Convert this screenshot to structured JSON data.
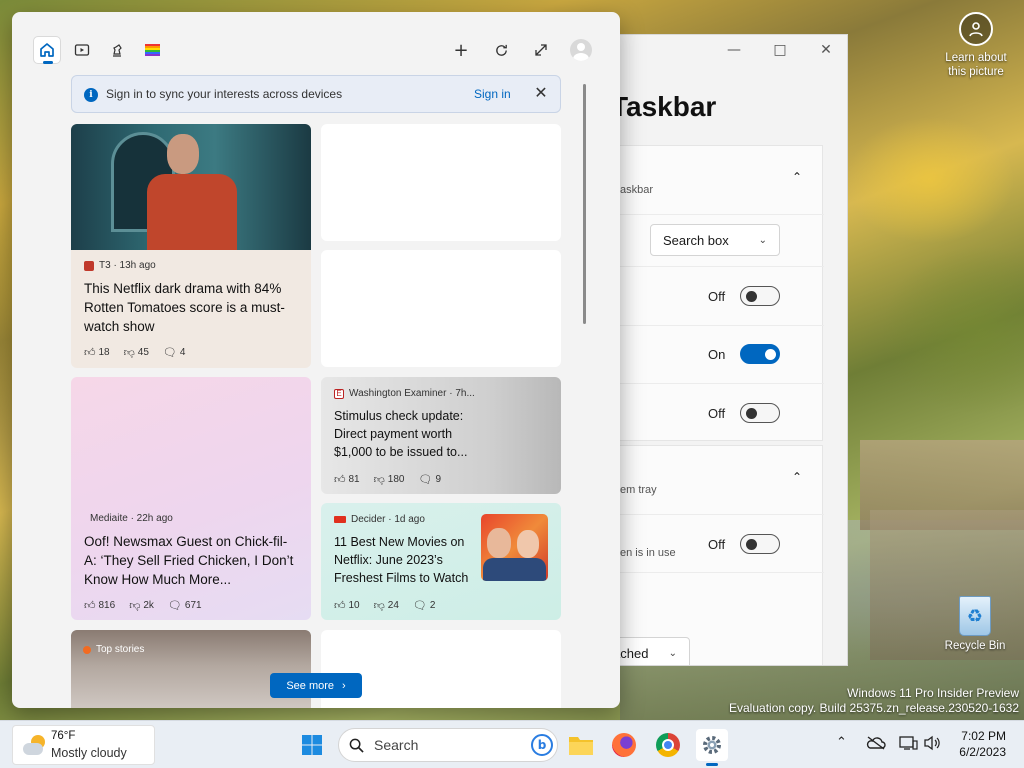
{
  "desktop": {
    "learn_about_line1": "Learn about",
    "learn_about_line2": "this picture",
    "recycle_bin": "Recycle Bin",
    "watermark_line1": "Windows 11 Pro Insider Preview",
    "watermark_line2": "Evaluation copy. Build 25375.zn_release.230520-1632"
  },
  "settings": {
    "title": "Taskbar",
    "section1_label": "askbar",
    "search_dropdown": "Search box",
    "toggle1_state": "Off",
    "toggle2_state": "On",
    "toggle3_state": "Off",
    "section2_label": "em tray",
    "row_label": "en is in use",
    "toggle4_state": "Off",
    "bottom_dropdown": "ached"
  },
  "widgets": {
    "banner": {
      "text": "Sign in to sync your interests across devices",
      "sign_in": "Sign in"
    },
    "cards": [
      {
        "source": "T3 · 13h ago",
        "headline": "This Netflix dark drama with 84% Rotten Tomatoes score is a must-watch show",
        "likes": "18",
        "dislikes": "45",
        "comments": "4"
      },
      {
        "source": "Washington Examiner · 7h...",
        "headline": "Stimulus check update: Direct payment worth $1,000 to be issued to...",
        "likes": "81",
        "dislikes": "180",
        "comments": "9"
      },
      {
        "source": "Mediaite · 22h ago",
        "headline": "Oof! Newsmax Guest on Chick-fil-A: ‘They Sell Fried Chicken, I Don’t Know How Much More...",
        "likes": "816",
        "dislikes": "2k",
        "comments": "671"
      },
      {
        "source": "Decider · 1d ago",
        "headline": "11 Best New Movies on Netflix: June 2023’s Freshest Films to Watch",
        "likes": "10",
        "dislikes": "24",
        "comments": "2"
      }
    ],
    "top_stories": "Top stories",
    "see_more": "See more"
  },
  "taskbar": {
    "temperature": "76°F",
    "condition": "Mostly cloudy",
    "search_placeholder": "Search",
    "time": "7:02 PM",
    "date": "6/2/2023"
  },
  "colors": {
    "accent": "#0067c0"
  }
}
